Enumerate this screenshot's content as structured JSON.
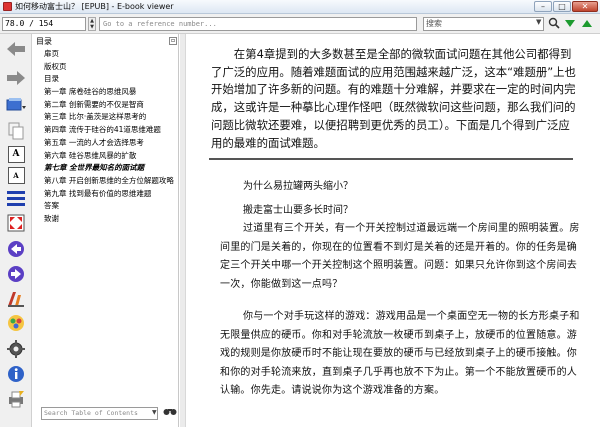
{
  "window": {
    "title": "如何移动富士山？ [EPUB] - E-book viewer",
    "buttons": {
      "minimize": "–",
      "maximize": "□",
      "close": "✕"
    }
  },
  "nav": {
    "position": "78.0 / 154",
    "reference_placeholder": "Go to a reference number...",
    "search_placeholder": "搜索",
    "icons": [
      "search-icon",
      "down-arrow-icon",
      "up-arrow-icon"
    ]
  },
  "toolbar": {
    "icons": [
      "back-icon",
      "forward-icon",
      "library-icon",
      "copy-icon",
      "font-larger-icon",
      "font-smaller-icon",
      "toc-icon",
      "fullscreen-icon",
      "previous-page-icon",
      "next-page-icon",
      "reference-mode-icon",
      "bookmark-icon",
      "preferences-icon",
      "info-icon",
      "print-icon"
    ],
    "font_larger": "A",
    "font_smaller": "A"
  },
  "toc": {
    "heading": "目录",
    "items": [
      "扉页",
      "版权页",
      "目录",
      "第一章 席卷硅谷的思维风暴",
      "第二章 创新需要的不仅是智商",
      "第三章 比尔·盖茨是这样思考的",
      "第四章 流传于硅谷的41道思维难题",
      "第五章 一流的人才会选择思考",
      "第六章 硅谷思维风暴的扩散",
      "第七章 全世界最知名的面试题",
      "第八章 开启创新思维的全方位解题攻略",
      "第九章 找到最有价值的思维难题",
      "答案",
      "致谢"
    ],
    "active_index": 9,
    "search_placeholder": "Search Table of Contents"
  },
  "content": {
    "intro": "在第4章提到的大多数甚至是全部的微软面试问题在其他公司都得到了广泛的应用。随着难题面试的应用范围越来越广泛，这本“难题册”上也开始增加了许多新的问题。有的难题十分难解，并要求在一定的时间内完成，这或许是一种摹比心理作怪吧（既然微软问这些问题，那么我们问的问题比微软还要难，以便招聘到更优秀的员工）。下面是几个得到广泛应用的最难的面试难题。",
    "question1": "为什么易拉罐两头缩小？",
    "question2": "搬走富士山要多长时间？",
    "paragraph1": "过道里有三个开关，有一个开关控制过道最远端一个房间里的照明装置。房间里的门是关着的，你现在的位置看不到灯是关着的还是开着的。你的任务是确定三个开关中哪一个开关控制这个照明装置。问题：如果只允许你到这个房间去一次，你能做到这一点吗？",
    "paragraph2": "你与一个对手玩这样的游戏：游戏用品是一个桌面空无一物的长方形桌子和无限量供应的硬币。你和对手轮流放一枚硬币到桌子上，放硬币的位置随意。游戏的规则是你放硬币时不能让现在要放的硬币与已经放到桌子上的硬币接触。你和你的对手轮流来放，直到桌子几乎再也放不下为止。第一个不能放置硬币的人认输。你先走。请说说你为这个游戏准备的方案。"
  }
}
